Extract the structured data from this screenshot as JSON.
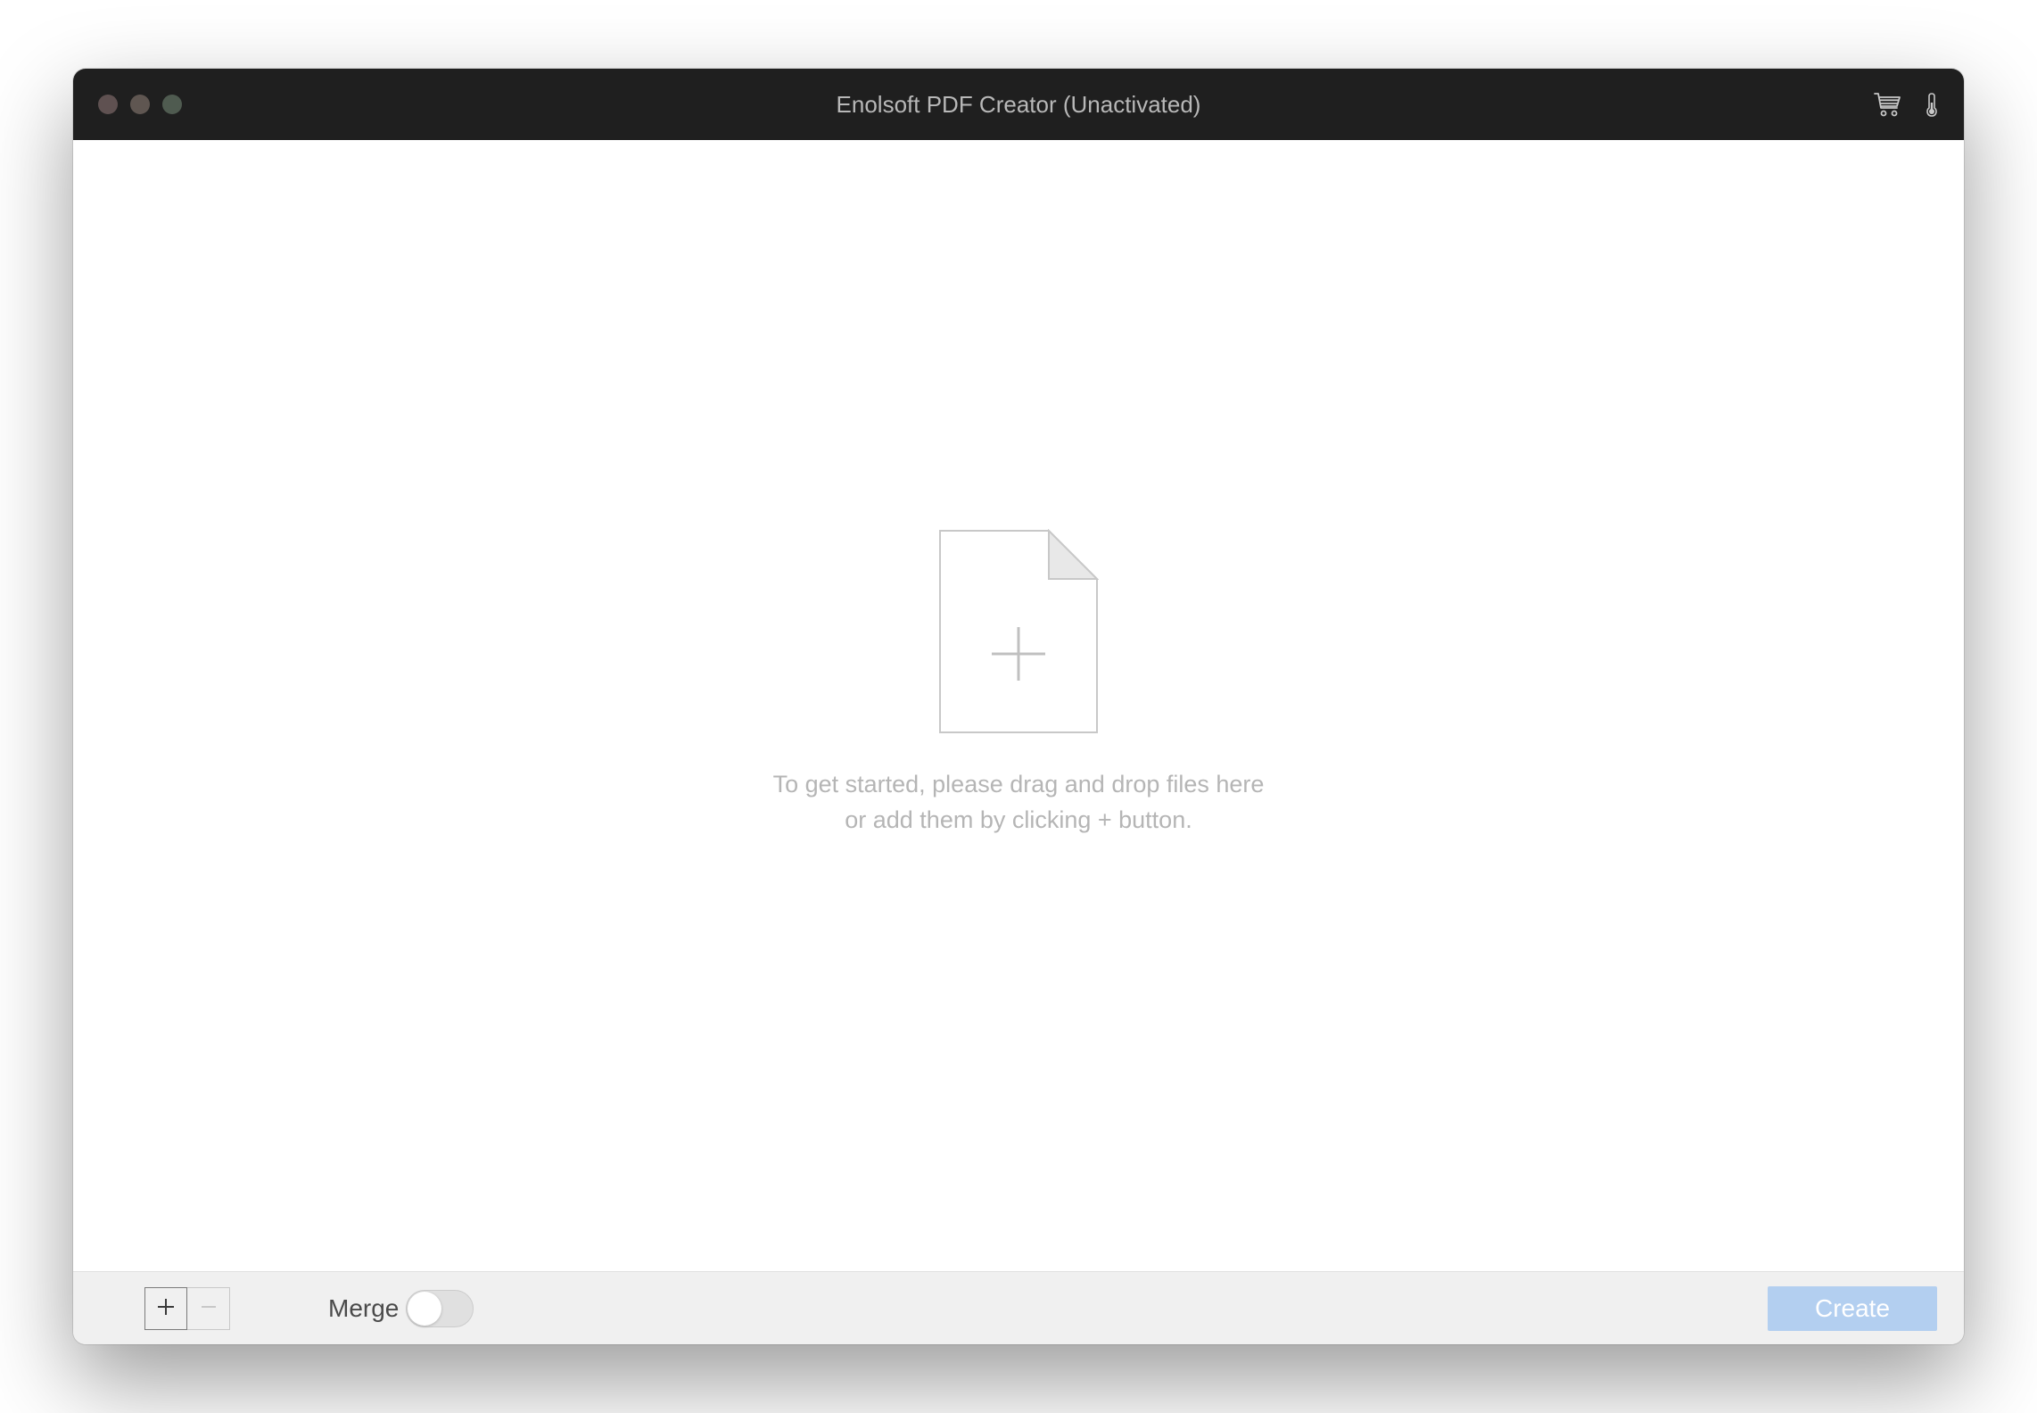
{
  "window": {
    "title": "Enolsoft PDF Creator (Unactivated)"
  },
  "content": {
    "hint_line1": "To get started, please drag and drop files here",
    "hint_line2": "or add them by clicking + button."
  },
  "bottombar": {
    "merge_label": "Merge",
    "create_label": "Create",
    "merge_state": "off"
  }
}
